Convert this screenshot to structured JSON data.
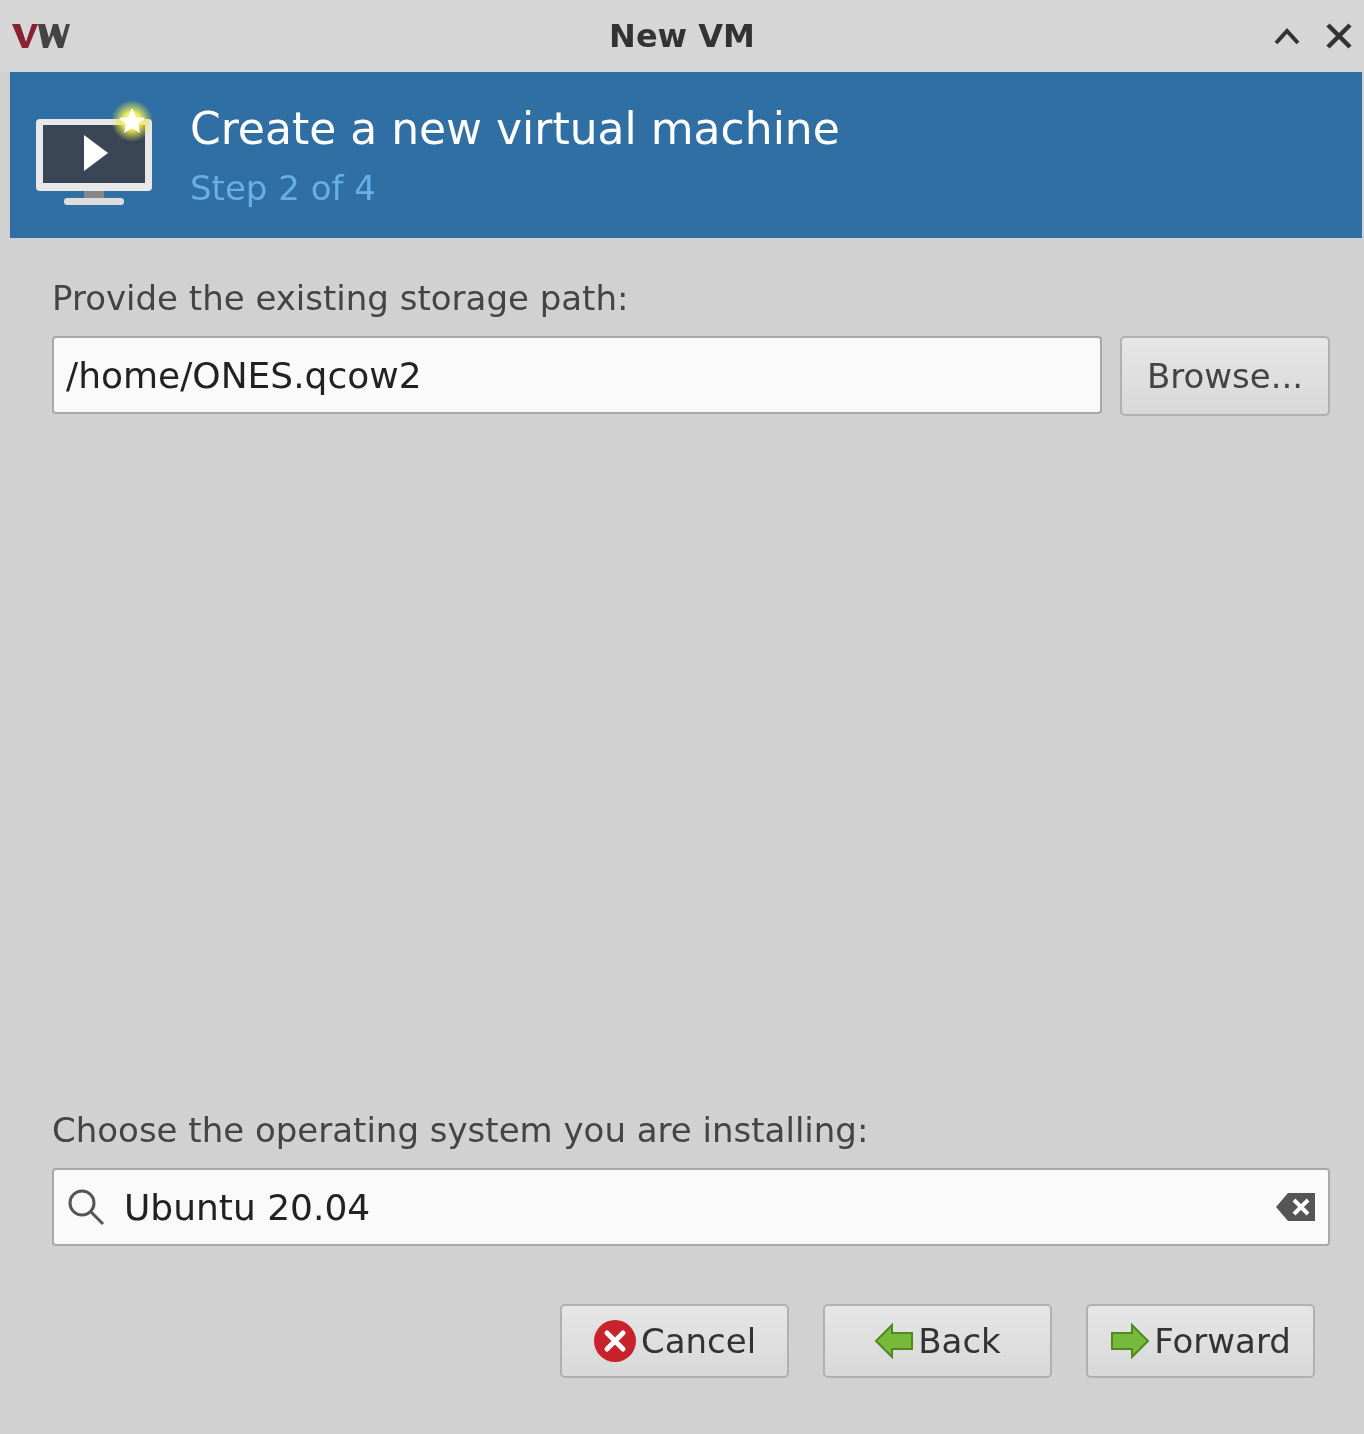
{
  "window": {
    "title": "New VM"
  },
  "header": {
    "title": "Create a new virtual machine",
    "step": "Step 2 of 4"
  },
  "storage": {
    "label": "Provide the existing storage path:",
    "value": "/home/ONES.qcow2",
    "browse": "Browse..."
  },
  "os": {
    "label": "Choose the operating system you are installing:",
    "value": "Ubuntu 20.04"
  },
  "buttons": [
    {
      "kind": "cancel",
      "label": "Cancel"
    },
    {
      "kind": "back",
      "label": "Back"
    },
    {
      "kind": "forward",
      "label": "Forward"
    }
  ]
}
